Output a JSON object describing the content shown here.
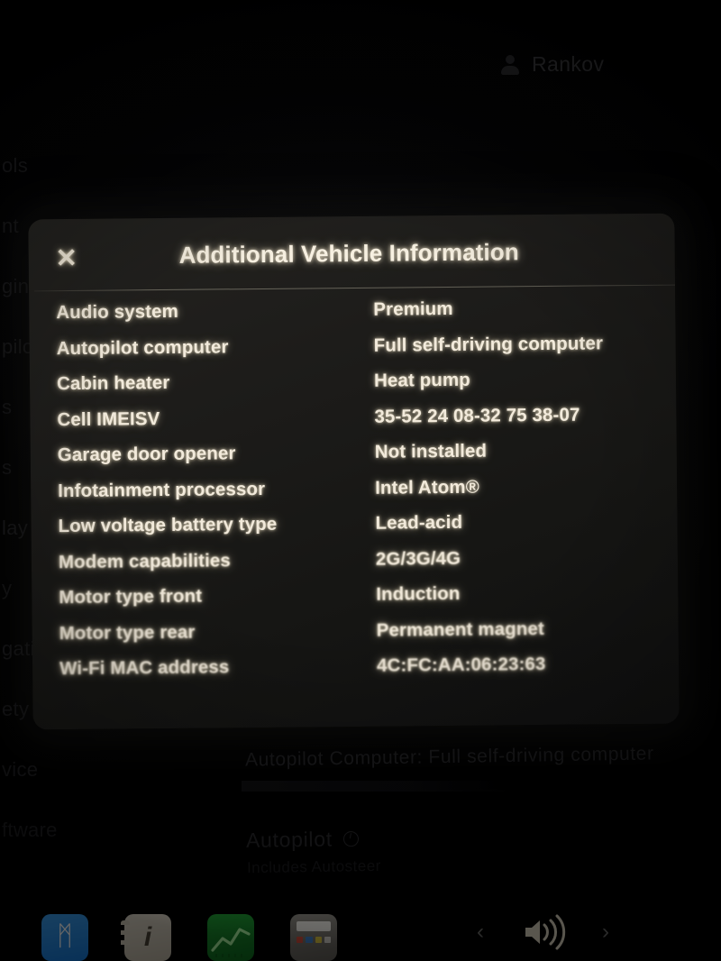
{
  "modal": {
    "title": "Additional Vehicle Information",
    "close_label": "✕",
    "rows": [
      {
        "label": "Audio system",
        "value": "Premium"
      },
      {
        "label": "Autopilot computer",
        "value": "Full self-driving computer"
      },
      {
        "label": "Cabin heater",
        "value": "Heat pump"
      },
      {
        "label": "Cell IMEISV",
        "value": "35-52 24 08-32 75 38-07"
      },
      {
        "label": "Garage door opener",
        "value": "Not installed"
      },
      {
        "label": "Infotainment processor",
        "value": "Intel Atom®"
      },
      {
        "label": "Low voltage battery type",
        "value": "Lead-acid"
      },
      {
        "label": "Modem capabilities",
        "value": "2G/3G/4G"
      },
      {
        "label": "Motor type front",
        "value": "Induction"
      },
      {
        "label": "Motor type rear",
        "value": "Permanent magnet"
      },
      {
        "label": "Wi-Fi MAC address",
        "value": "4C:FC:AA:06:23:63"
      }
    ]
  },
  "background": {
    "profile_name": "Rankov",
    "sidebar_items": [
      {
        "label": "ols"
      },
      {
        "label": "nt"
      },
      {
        "label": "ging"
      },
      {
        "label": "pilot"
      },
      {
        "label": "s"
      },
      {
        "label": "s"
      },
      {
        "label": "lay"
      },
      {
        "label": "y"
      },
      {
        "label": "gation"
      },
      {
        "label": "ety"
      },
      {
        "label": "vice"
      },
      {
        "label": "ftware"
      }
    ],
    "autopilot_computer_line": "Autopilot Computer: Full self-driving computer",
    "autopilot_section_label": "Autopilot",
    "autopilot_subtext": "Includes Autosteer"
  },
  "taskbar": {
    "bluetooth_glyph": "ᛗ",
    "contacts_glyph": "i",
    "chevron_left": "‹",
    "chevron_right": "›"
  },
  "colors": {
    "modal_bg": "#1d1c1a",
    "text": "#f2eadb",
    "bluetooth_blue": "#1579d8",
    "stocks_green": "#1f9b33",
    "calculator_gray": "#605d57"
  }
}
